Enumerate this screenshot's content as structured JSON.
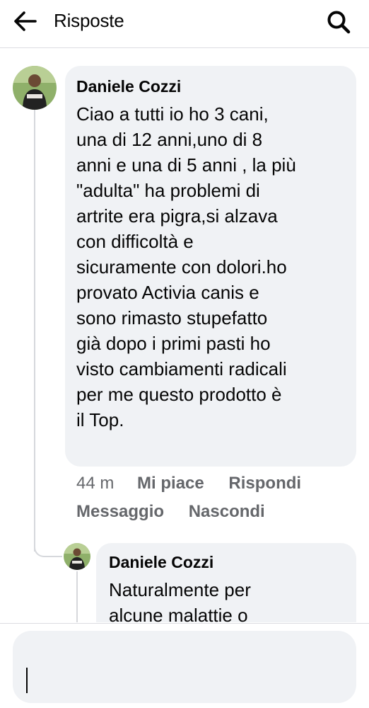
{
  "header": {
    "title": "Risposte",
    "back_icon": "arrow-left-icon",
    "search_icon": "search-icon"
  },
  "comment": {
    "author": "Daniele Cozzi",
    "text": "Ciao a tutti io ho 3 cani,\nuna di 12 anni,uno di 8\nanni e una di 5 anni , la più\n\"adulta\" ha problemi di\nartrite era pigra,si alzava\ncon difficoltà e\nsicuramente con dolori.ho\nprovato Activia canis e\nsono rimasto stupefatto\ngià dopo i primi pasti ho\nvisto cambiamenti radicali\nper me questo prodotto è\nil Top.",
    "time": "44 m",
    "like_label": "Mi piace",
    "reply_label": "Rispondi",
    "message_label": "Messaggio",
    "hide_label": "Nascondi"
  },
  "reply": {
    "author": "Daniele Cozzi",
    "text": "Naturalmente per\nalcune malattie o"
  },
  "composer": {
    "value": ""
  },
  "colors": {
    "bubble": "#f0f2f5",
    "secondary_text": "#65676b",
    "primary_text": "#050505",
    "thread_line": "#d6d8dc"
  }
}
